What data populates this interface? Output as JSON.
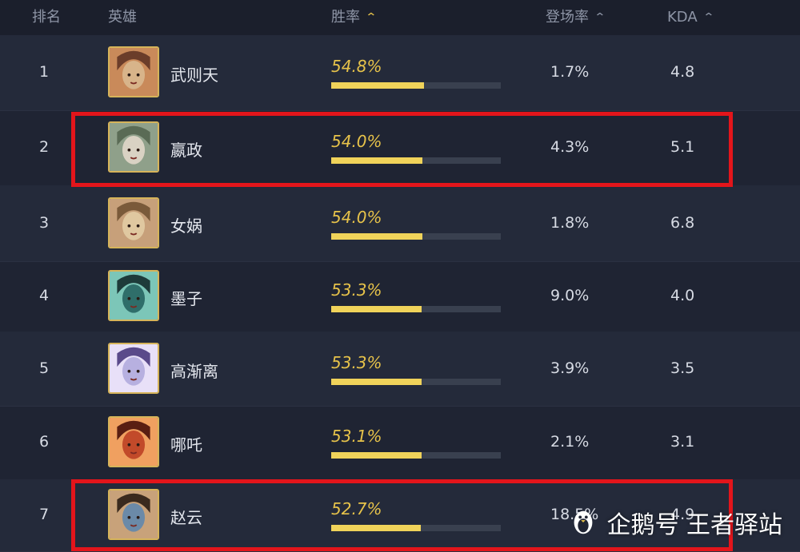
{
  "header": {
    "rank_label": "排名",
    "hero_label": "英雄",
    "winrate_label": "胜率",
    "pickrate_label": "登场率",
    "kda_label": "KDA"
  },
  "colors": {
    "background": "#1f2433",
    "accent": "#e7c34a",
    "highlight": "#e3151b"
  },
  "rows": [
    {
      "rank": "1",
      "name": "武则天",
      "winrate": "54.8%",
      "winrate_fraction": 0.548,
      "pickrate": "1.7%",
      "kda": "4.8",
      "highlighted": false
    },
    {
      "rank": "2",
      "name": "嬴政",
      "winrate": "54.0%",
      "winrate_fraction": 0.54,
      "pickrate": "4.3%",
      "kda": "5.1",
      "highlighted": true
    },
    {
      "rank": "3",
      "name": "女娲",
      "winrate": "54.0%",
      "winrate_fraction": 0.54,
      "pickrate": "1.8%",
      "kda": "6.8",
      "highlighted": false
    },
    {
      "rank": "4",
      "name": "墨子",
      "winrate": "53.3%",
      "winrate_fraction": 0.533,
      "pickrate": "9.0%",
      "kda": "4.0",
      "highlighted": false
    },
    {
      "rank": "5",
      "name": "高渐离",
      "winrate": "53.3%",
      "winrate_fraction": 0.533,
      "pickrate": "3.9%",
      "kda": "3.5",
      "highlighted": false
    },
    {
      "rank": "6",
      "name": "哪吒",
      "winrate": "53.1%",
      "winrate_fraction": 0.531,
      "pickrate": "2.1%",
      "kda": "3.1",
      "highlighted": false
    },
    {
      "rank": "7",
      "name": "赵云",
      "winrate": "52.7%",
      "winrate_fraction": 0.527,
      "pickrate": "18.5%",
      "kda": "4.9",
      "highlighted": true
    }
  ],
  "watermark": {
    "text": "企鹅号 王者驿站",
    "icon": "penguin-icon"
  }
}
